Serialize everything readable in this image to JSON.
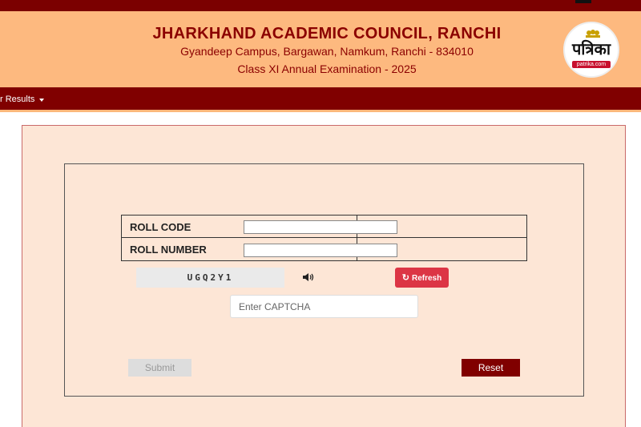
{
  "header": {
    "title": "JHARKHAND ACADEMIC COUNCIL, RANCHI",
    "address": "Gyandeep Campus, Bargawan, Namkum, Ranchi - 834010",
    "exam": "Class XI Annual Examination - 2025"
  },
  "logo": {
    "text": "पत्रिका",
    "website": "patrika.com"
  },
  "nav": {
    "item_label": "r Results"
  },
  "form": {
    "roll_code_label": "ROLL CODE",
    "roll_number_label": "ROLL NUMBER",
    "roll_code_value": "",
    "roll_number_value": ""
  },
  "captcha": {
    "code": "UGQ2Y1",
    "refresh_label": "Refresh",
    "input_placeholder": "Enter CAPTCHA",
    "input_value": ""
  },
  "actions": {
    "submit_label": "Submit",
    "reset_label": "Reset"
  },
  "colors": {
    "brand_maroon": "#800000",
    "header_bg": "#fdb97f",
    "panel_bg": "#fde6d6",
    "refresh_red": "#dc3545"
  },
  "icons": {
    "speaker": "speaker-icon",
    "refresh": "refresh-icon",
    "caret": "caret-down-icon"
  }
}
